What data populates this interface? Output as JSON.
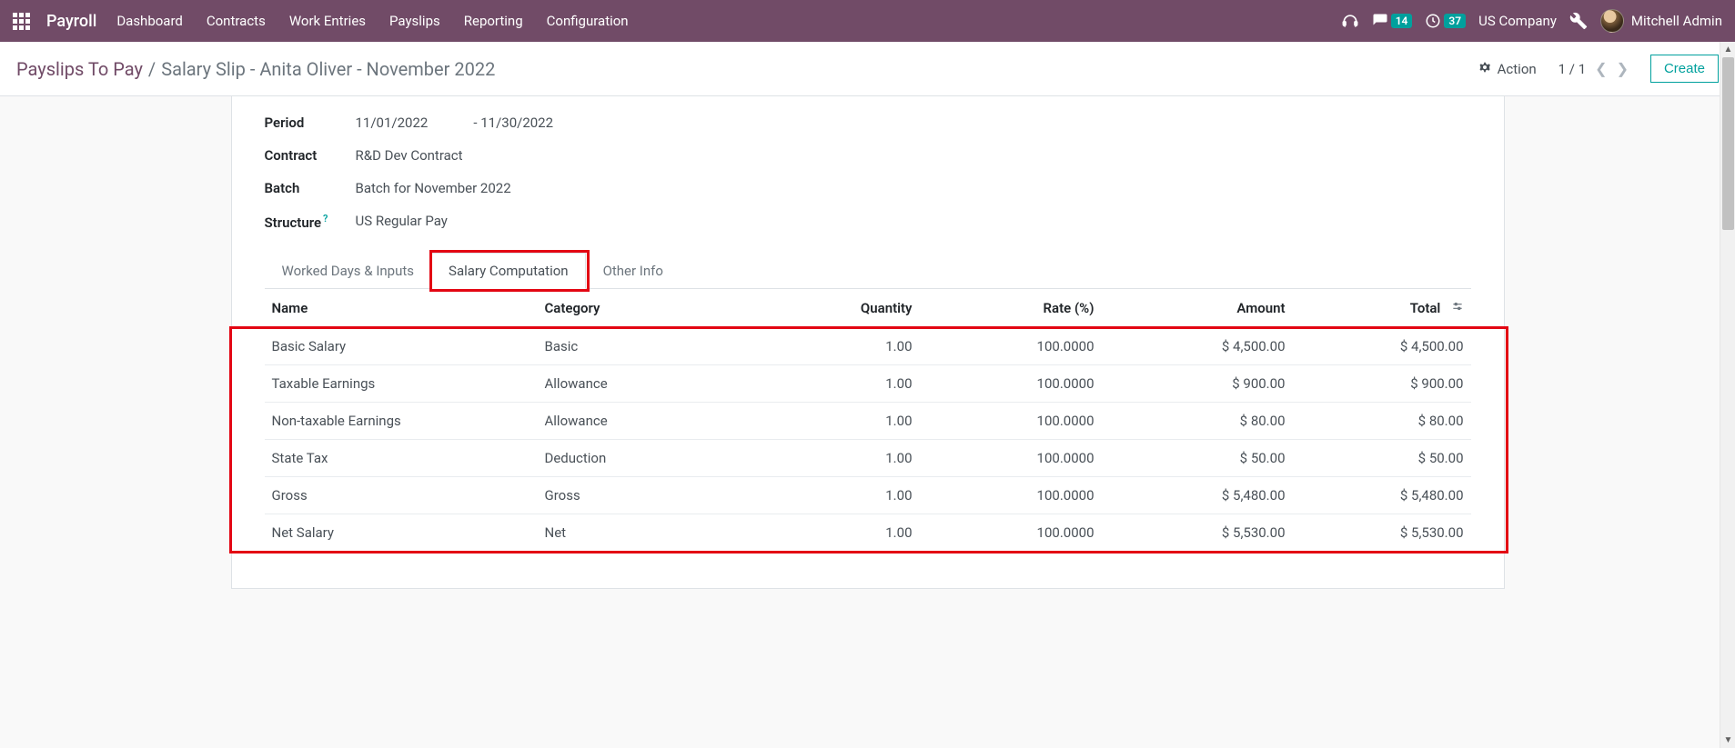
{
  "nav": {
    "brand": "Payroll",
    "menu": [
      "Dashboard",
      "Contracts",
      "Work Entries",
      "Payslips",
      "Reporting",
      "Configuration"
    ],
    "messages_badge": "14",
    "activities_badge": "37",
    "company": "US Company",
    "user": "Mitchell Admin"
  },
  "control_panel": {
    "breadcrumb_root": "Payslips To Pay",
    "breadcrumb_current": "Salary Slip - Anita Oliver - November 2022",
    "action_label": "Action",
    "pager": "1 / 1",
    "create_label": "Create"
  },
  "fields": {
    "period_label": "Period",
    "period_from": "11/01/2022",
    "period_sep": "-",
    "period_to": "11/30/2022",
    "contract_label": "Contract",
    "contract_value": "R&D Dev Contract",
    "batch_label": "Batch",
    "batch_value": "Batch for November 2022",
    "structure_label": "Structure",
    "structure_value": "US Regular Pay"
  },
  "tabs": {
    "t0": "Worked Days & Inputs",
    "t1": "Salary Computation",
    "t2": "Other Info"
  },
  "table": {
    "headers": {
      "name": "Name",
      "category": "Category",
      "quantity": "Quantity",
      "rate": "Rate (%)",
      "amount": "Amount",
      "total": "Total"
    },
    "rows": [
      {
        "name": "Basic Salary",
        "category": "Basic",
        "quantity": "1.00",
        "rate": "100.0000",
        "amount": "$ 4,500.00",
        "total": "$ 4,500.00"
      },
      {
        "name": "Taxable Earnings",
        "category": "Allowance",
        "quantity": "1.00",
        "rate": "100.0000",
        "amount": "$ 900.00",
        "total": "$ 900.00"
      },
      {
        "name": "Non-taxable Earnings",
        "category": "Allowance",
        "quantity": "1.00",
        "rate": "100.0000",
        "amount": "$ 80.00",
        "total": "$ 80.00"
      },
      {
        "name": "State Tax",
        "category": "Deduction",
        "quantity": "1.00",
        "rate": "100.0000",
        "amount": "$ 50.00",
        "total": "$ 50.00"
      },
      {
        "name": "Gross",
        "category": "Gross",
        "quantity": "1.00",
        "rate": "100.0000",
        "amount": "$ 5,480.00",
        "total": "$ 5,480.00"
      },
      {
        "name": "Net Salary",
        "category": "Net",
        "quantity": "1.00",
        "rate": "100.0000",
        "amount": "$ 5,530.00",
        "total": "$ 5,530.00"
      }
    ]
  }
}
